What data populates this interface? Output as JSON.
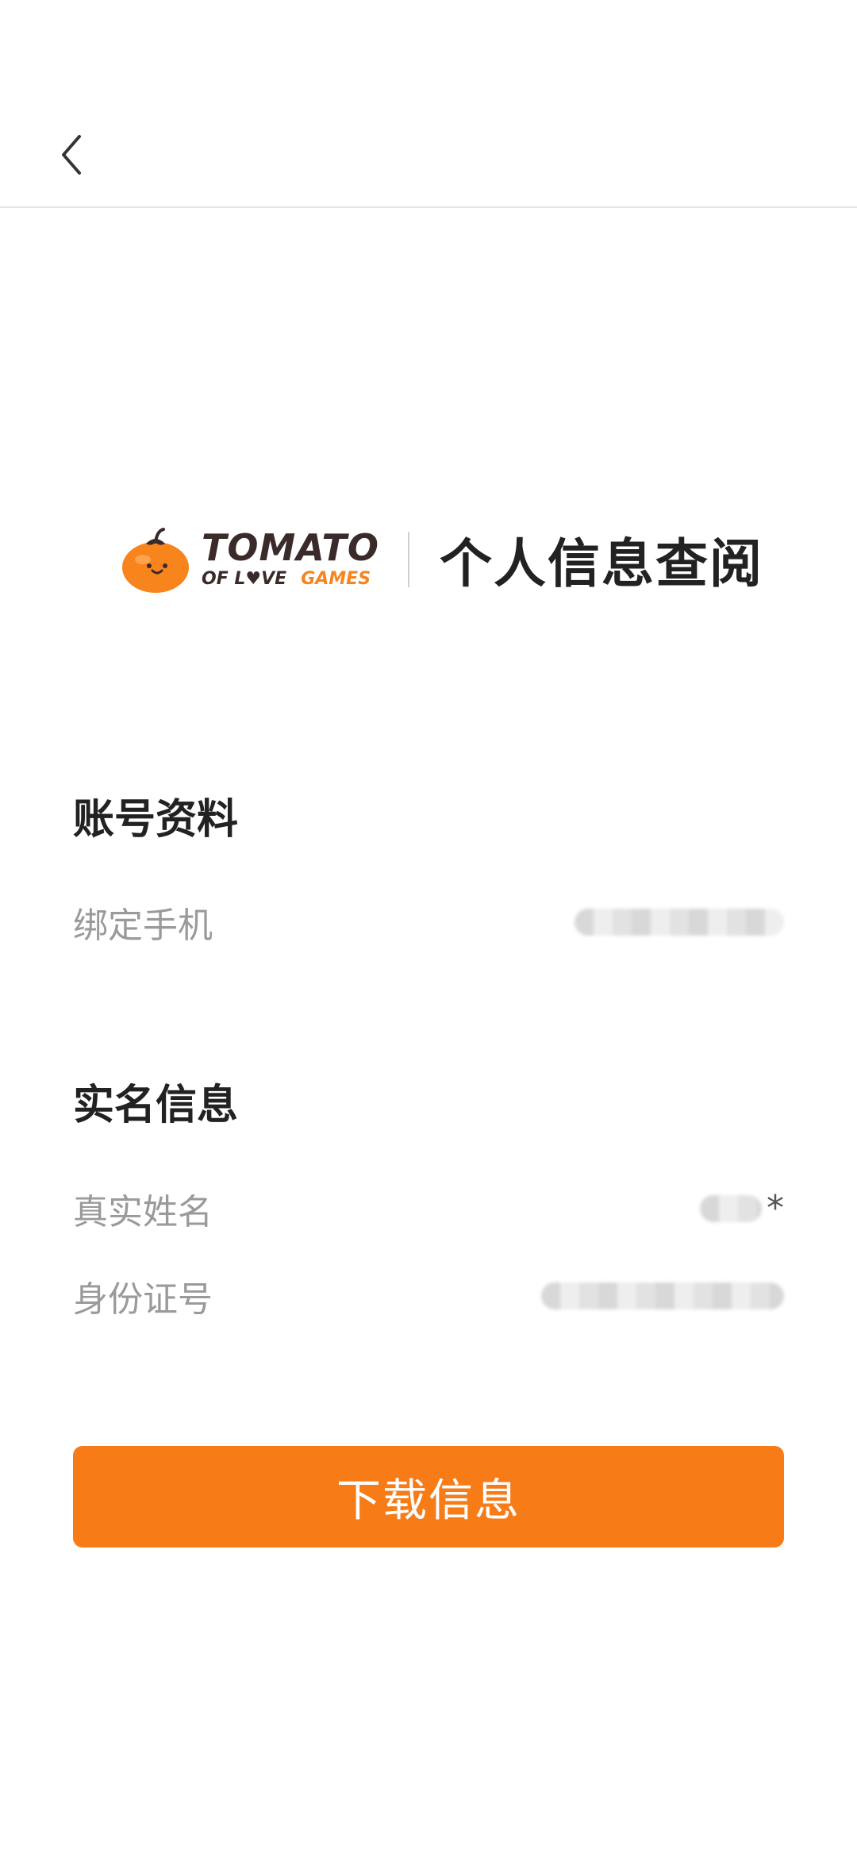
{
  "header": {
    "brand_name": "TOMATO",
    "brand_sub_left": "OF L♥VE",
    "brand_sub_right": "GAMES",
    "title": "个人信息查阅"
  },
  "account": {
    "section_title": "账号资料",
    "phone_label": "绑定手机"
  },
  "realname": {
    "section_title": "实名信息",
    "name_label": "真实姓名",
    "name_suffix": "*",
    "id_label": "身份证号"
  },
  "actions": {
    "download_label": "下载信息"
  },
  "colors": {
    "accent": "#f77b17",
    "label_gray": "#9a9a9a",
    "text_dark": "#222222"
  },
  "icons": {
    "back": "chevron-left-icon",
    "logo": "tomato-logo-icon"
  }
}
